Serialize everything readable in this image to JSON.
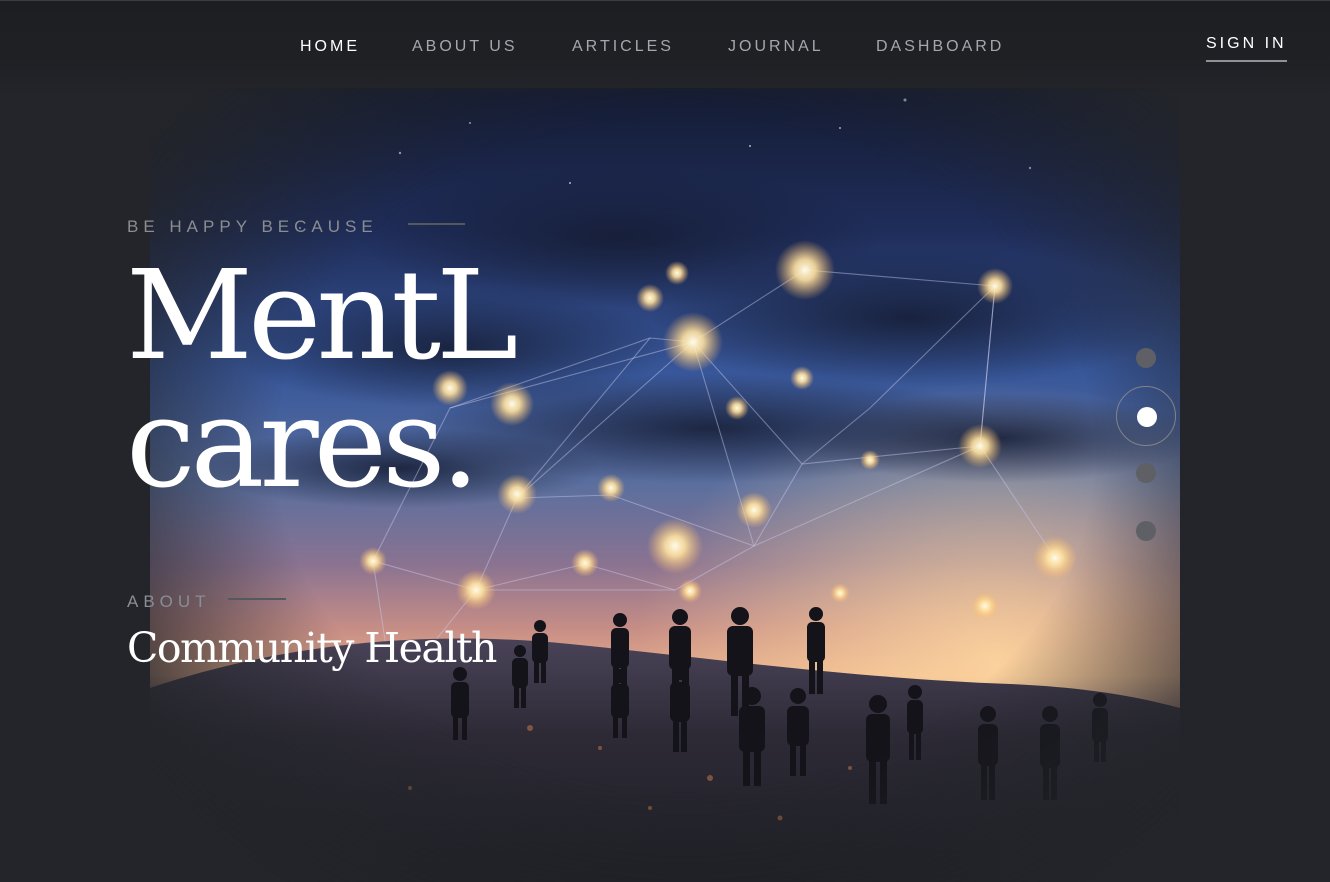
{
  "nav": {
    "items": [
      {
        "label": "HOME",
        "active": true
      },
      {
        "label": "ABOUT US",
        "active": false
      },
      {
        "label": "ARTICLES",
        "active": false
      },
      {
        "label": "JOURNAL",
        "active": false
      },
      {
        "label": "DASHBOARD",
        "active": false
      }
    ],
    "sign_in": "SIGN IN"
  },
  "hero": {
    "eyebrow": "BE HAPPY BECAUSE",
    "headline_line1": "MentL",
    "headline_line2": "cares.",
    "about_label": "ABOUT",
    "subtitle": "Community Health",
    "image_icon": "network-constellation-people-image"
  },
  "slider": {
    "slide_count": 4,
    "active_index": 1
  },
  "colors": {
    "background": "#23252a",
    "text_primary": "#ffffff",
    "text_muted": "#a4a7ad",
    "dot_inactive": "#5e6065",
    "sky_blue": "#3d5c9e",
    "glow_warm": "#ffe3a8"
  }
}
